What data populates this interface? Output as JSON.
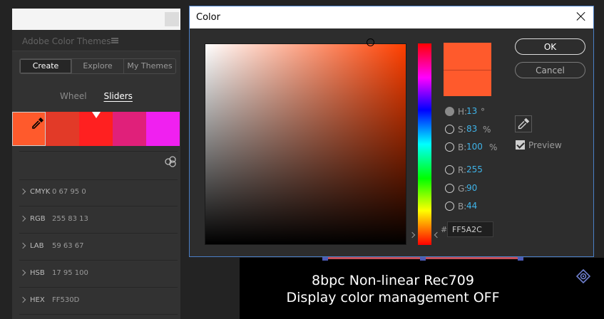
{
  "panel": {
    "title": "Adobe Color Themes",
    "mode_tabs": [
      {
        "label": "Create",
        "active": true
      },
      {
        "label": "Explore",
        "active": false
      },
      {
        "label": "My Themes",
        "active": false
      }
    ],
    "sub_tabs": [
      {
        "label": "Wheel",
        "active": false
      },
      {
        "label": "Sliders",
        "active": true
      }
    ],
    "swatches": [
      "#ff5a2c",
      "#e23a28",
      "#ff2020",
      "#e0207a",
      "#f020f0"
    ],
    "values": [
      {
        "label": "CMYK",
        "value": "0   67   95   0"
      },
      {
        "label": "RGB",
        "value": "255   83   13"
      },
      {
        "label": "LAB",
        "value": "59   63   67"
      },
      {
        "label": "HSB",
        "value": "17   95   100"
      },
      {
        "label": "HEX",
        "value": "FF530D"
      }
    ]
  },
  "viewer": {
    "line1": "8bpc Non-linear Rec709",
    "line2": "Display color management OFF"
  },
  "dialog": {
    "title": "Color",
    "ok_label": "OK",
    "cancel_label": "Cancel",
    "preview_label": "Preview",
    "preview_checked": true,
    "new_color": "#ff5a2c",
    "old_color": "#ff5a2c",
    "hsb": [
      {
        "label": "H:",
        "value": "13",
        "unit": "°",
        "selected": true
      },
      {
        "label": "S:",
        "value": "83",
        "unit": "%",
        "selected": false
      },
      {
        "label": "B:",
        "value": "100",
        "unit": "%",
        "selected": false
      }
    ],
    "rgb": [
      {
        "label": "R:",
        "value": "255",
        "selected": false
      },
      {
        "label": "G:",
        "value": "90",
        "selected": false
      },
      {
        "label": "B:",
        "value": "44",
        "selected": false
      }
    ],
    "hex_prefix": "#",
    "hex_value": "FF5A2C"
  }
}
